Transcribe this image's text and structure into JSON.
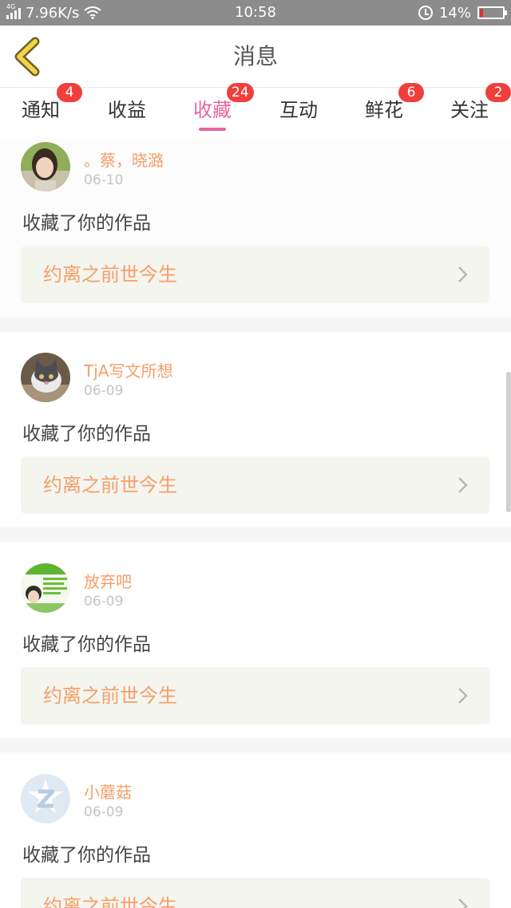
{
  "status_bar": {
    "network": "4G",
    "speed": "7.96K/s",
    "time": "10:58",
    "battery": "14%",
    "battery_level": 0.14
  },
  "header": {
    "title": "消息"
  },
  "tabs": [
    {
      "label": "通知",
      "badge": "4"
    },
    {
      "label": "收益",
      "badge": ""
    },
    {
      "label": "收藏",
      "badge": "24",
      "active": true
    },
    {
      "label": "互动",
      "badge": ""
    },
    {
      "label": "鲜花",
      "badge": "6"
    },
    {
      "label": "关注",
      "badge": "2"
    }
  ],
  "feed": [
    {
      "name": "。蔡，晓潞",
      "date": "06-10",
      "action": "收藏了你的作品",
      "work": "约离之前世今生",
      "avatar": "woman-avatar"
    },
    {
      "name": "TjA写文所想",
      "date": "06-09",
      "action": "收藏了你的作品",
      "work": "约离之前世今生",
      "avatar": "cat-avatar"
    },
    {
      "name": "放弃吧",
      "date": "06-09",
      "action": "收藏了你的作品",
      "work": "约离之前世今生",
      "avatar": "green-poster-avatar"
    },
    {
      "name": "小蘑菇",
      "date": "06-09",
      "action": "收藏了你的作品",
      "work": "约离之前世今生",
      "avatar": "default-z-avatar"
    }
  ],
  "colors": {
    "accent": "#e8659f",
    "badge": "#f0403c",
    "name_orange": "#f3a06a",
    "status_bar": "#8c8c8c",
    "back_arrow": "#f2d34a"
  }
}
